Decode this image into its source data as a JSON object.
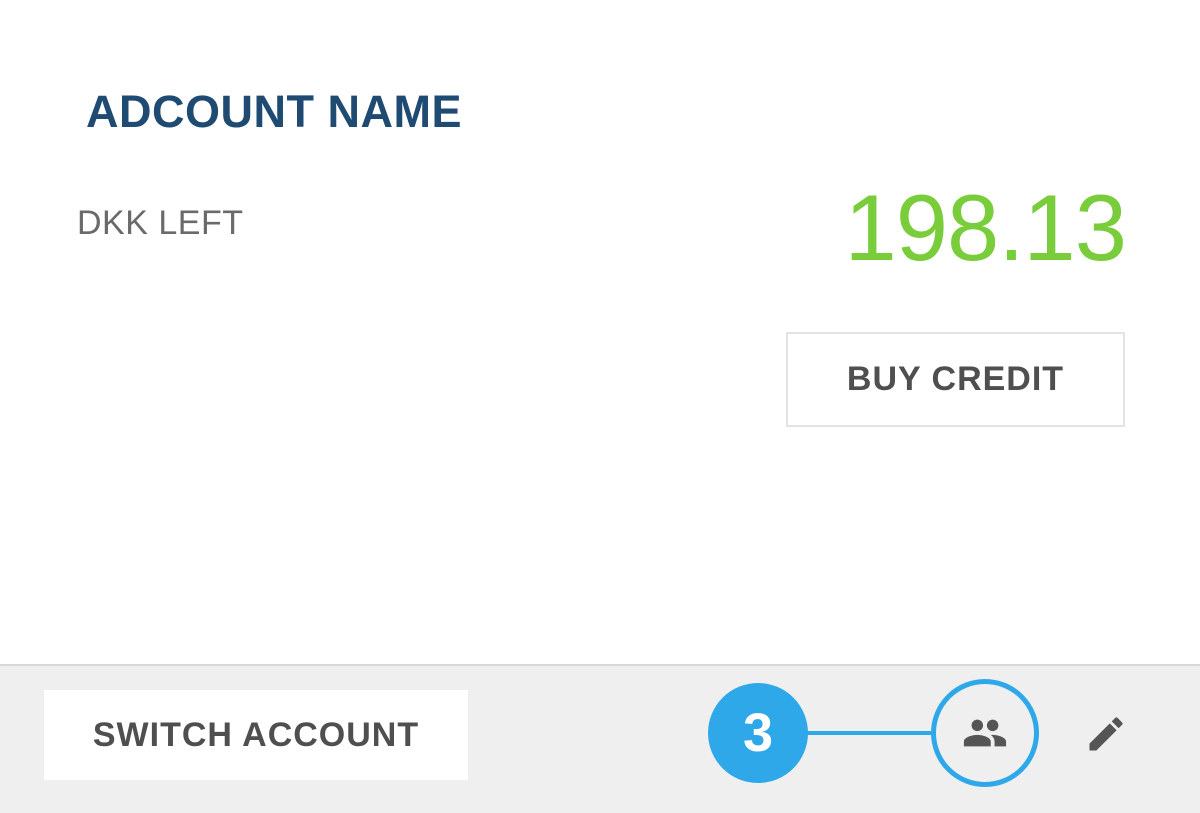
{
  "account": {
    "name": "ADCOUNT NAME",
    "balance_label": "DKK LEFT",
    "balance_value": "198.13"
  },
  "actions": {
    "buy_credit_label": "BUY CREDIT",
    "switch_account_label": "SWITCH ACCOUNT"
  },
  "callout": {
    "step_number": "3"
  },
  "icons": {
    "members": "people-icon",
    "edit": "pencil-icon"
  },
  "colors": {
    "account_name": "#1f4a72",
    "balance_value": "#79cc3a",
    "callout": "#2fa8ea",
    "footer_bg": "#efefef"
  }
}
